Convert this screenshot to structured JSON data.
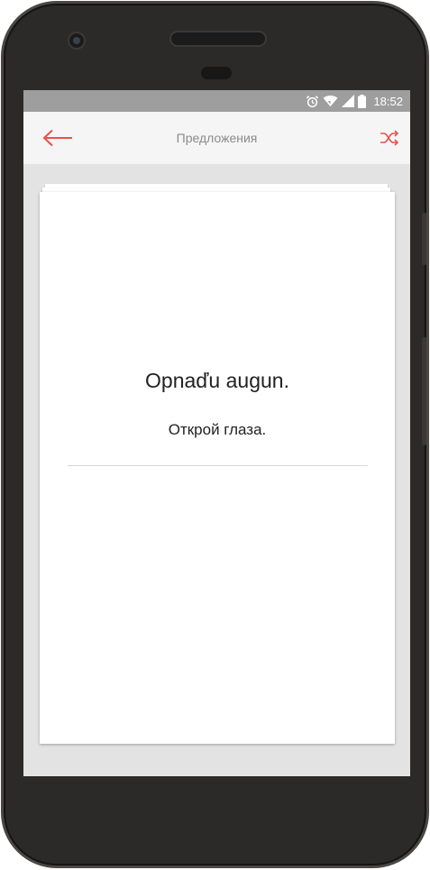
{
  "status_bar": {
    "time": "18:52",
    "icons": [
      "alarm-icon",
      "wifi-icon",
      "signal-icon",
      "battery-icon"
    ]
  },
  "app_bar": {
    "title": "Предложения",
    "back_icon": "arrow-left-icon",
    "shuffle_icon": "shuffle-icon"
  },
  "card": {
    "sentence": "Opnaďu augun.",
    "translation": "Открой глаза."
  },
  "colors": {
    "accent": "#e5534b",
    "status_bar": "#9e9e9e",
    "app_bar": "#f5f5f5",
    "background": "#e3e3e3"
  }
}
